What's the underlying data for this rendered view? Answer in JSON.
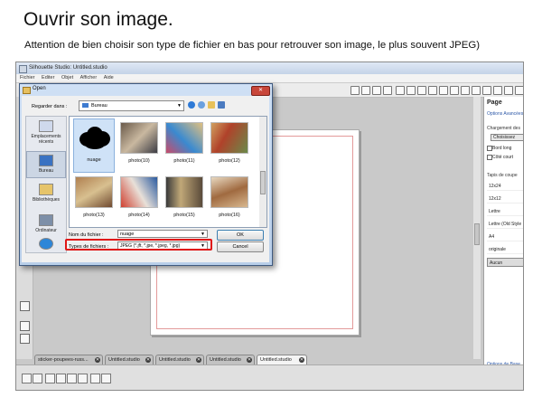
{
  "slide": {
    "title": "Ouvrir son image.",
    "subtitle": "Attention de bien choisir son type de fichier en bas pour retrouver son image, le plus souvent JPEG)"
  },
  "window": {
    "title": "Silhouette Studio: Untitled.studio",
    "menu": [
      "Fichier",
      "Editer",
      "Objet",
      "Afficher",
      "Aide"
    ]
  },
  "panel": {
    "heading": "Page",
    "advanced": "Options Avancées",
    "loading_label": "Chargement des",
    "choose_label": "Choisissez",
    "opt1": "Bord long",
    "opt2": "Côté court",
    "mat_label": "Tapis de coupe",
    "mats": [
      "12x24",
      "12x12",
      "Lettre",
      "Lettre (Old Style",
      "A4",
      "originale",
      "Aucun"
    ],
    "footer": "Options de Base"
  },
  "tabs": [
    {
      "label": "sticker-poupees-russ..."
    },
    {
      "label": "Untitled.studio"
    },
    {
      "label": "Untitled.studio"
    },
    {
      "label": "Untitled.studio"
    },
    {
      "label": "Untitled.studio"
    }
  ],
  "dialog": {
    "title": "Open",
    "look_in_label": "Regarder dans :",
    "look_in_value": "Bureau",
    "places": [
      {
        "label": "Emplacements récents"
      },
      {
        "label": "Bureau"
      },
      {
        "label": "Bibliothèques"
      },
      {
        "label": "Ordinateur"
      },
      {
        "label": ""
      }
    ],
    "files": [
      "nuage",
      "photo(10)",
      "photo(11)",
      "photo(12)",
      "photo(13)",
      "photo(14)",
      "photo(15)",
      "photo(16)"
    ],
    "filename_label": "Nom du fichier :",
    "filename_value": "nuage",
    "filetype_label": "Types de fichiers :",
    "filetype_value": "JPEG (*.jft, *.jpe, *.jpeg, *.jpg)",
    "ok_label": "OK",
    "cancel_label": "Cancel"
  },
  "colors": {
    "highlight": "#e01818",
    "selection": "#cfe2f7"
  }
}
